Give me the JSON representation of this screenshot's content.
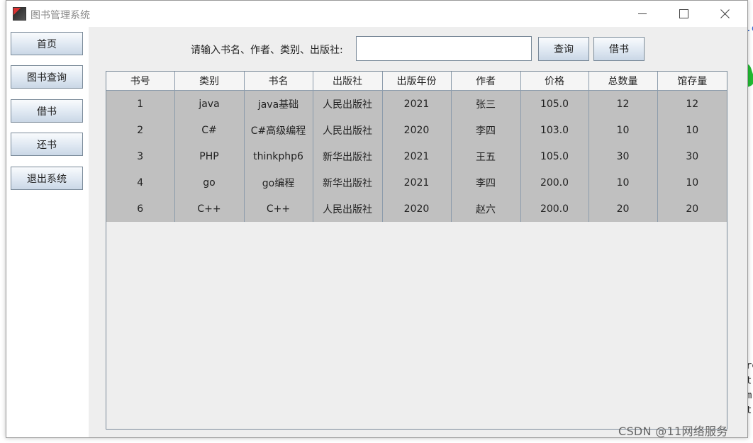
{
  "window": {
    "title": "图书管理系统"
  },
  "sidebar": {
    "items": [
      {
        "label": "首页"
      },
      {
        "label": "图书查询"
      },
      {
        "label": "借书"
      },
      {
        "label": "还书"
      },
      {
        "label": "退出系统"
      }
    ]
  },
  "search": {
    "label": "请输入书名、作者、类别、出版社:",
    "value": "",
    "query_button": "查询",
    "borrow_button": "借书"
  },
  "table": {
    "columns": [
      "书号",
      "类别",
      "书名",
      "出版社",
      "出版年份",
      "作者",
      "价格",
      "总数量",
      "馆存量"
    ],
    "rows": [
      [
        "1",
        "java",
        "java基础",
        "人民出版社",
        "2021",
        "张三",
        "105.0",
        "12",
        "12"
      ],
      [
        "2",
        "C#",
        "C#高级编程",
        "人民出版社",
        "2020",
        "李四",
        "103.0",
        "10",
        "10"
      ],
      [
        "3",
        "PHP",
        "thinkphp6",
        "新华出版社",
        "2021",
        "王五",
        "105.0",
        "30",
        "30"
      ],
      [
        "4",
        "go",
        "go编程",
        "新华出版社",
        "2021",
        "李四",
        "200.0",
        "10",
        "10"
      ],
      [
        "6",
        "C++",
        "C++",
        "人民出版社",
        "2020",
        "赵六",
        "200.0",
        "20",
        "20"
      ]
    ]
  },
  "watermark": "CSDN @11网络服务",
  "background": {
    "partial_e": ".e",
    "partial_text": "re\nt\nm\nt"
  },
  "icons": {
    "app": "java-app-icon",
    "minimize": "minimize-icon",
    "maximize": "maximize-icon",
    "close": "close-icon"
  }
}
